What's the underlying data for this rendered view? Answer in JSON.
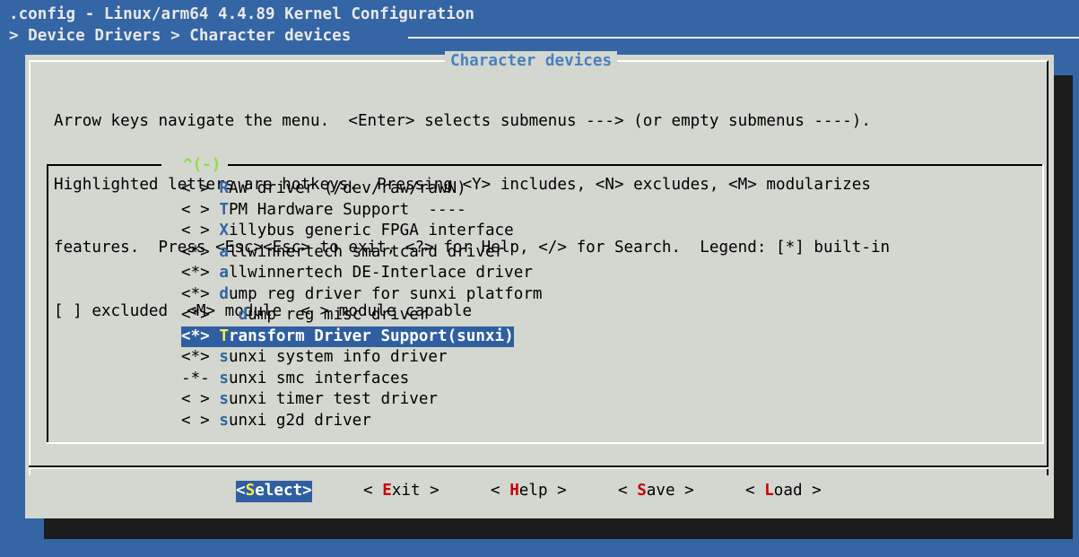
{
  "window": {
    "title": ".config - Linux/arm64 4.4.89 Kernel Configuration",
    "breadcrumb": "> Device Drivers > Character devices"
  },
  "dialog": {
    "title": "Character devices",
    "help_lines": [
      "Arrow keys navigate the menu.  <Enter> selects submenus ---> (or empty submenus ----).",
      "Highlighted letters are hotkeys.  Pressing <Y> includes, <N> excludes, <M> modularizes",
      "features.  Press <Esc><Esc> to exit, <?> for Help, </> for Search.  Legend: [*] built-in",
      "[ ] excluded  <M> module  < > module capable"
    ],
    "scroll_indicator": "^(-)"
  },
  "menu": {
    "items": [
      {
        "prefix": "< > ",
        "hot": "R",
        "rest": "AW driver (/dev/raw/rawN)"
      },
      {
        "prefix": "< > ",
        "hot": "T",
        "rest": "PM Hardware Support  ----"
      },
      {
        "prefix": "< > ",
        "hot": "X",
        "rest": "illybus generic FPGA interface"
      },
      {
        "prefix": "<*> ",
        "hot": "a",
        "rest": "llwinnertech smartcard driver"
      },
      {
        "prefix": "<*> ",
        "hot": "a",
        "rest": "llwinnertech DE-Interlace driver"
      },
      {
        "prefix": "<*> ",
        "hot": "d",
        "rest": "ump reg driver for sunxi platform"
      },
      {
        "prefix": "<*>   ",
        "hot": "d",
        "rest": "ump reg misc driver"
      },
      {
        "prefix": "<*> ",
        "hot": "T",
        "rest": "ransform Driver Support(sunxi)"
      },
      {
        "prefix": "<*> ",
        "hot": "s",
        "rest": "unxi system info driver"
      },
      {
        "prefix": "-*- ",
        "hot": "s",
        "rest": "unxi smc interfaces"
      },
      {
        "prefix": "< > ",
        "hot": "s",
        "rest": "unxi timer test driver"
      },
      {
        "prefix": "< > ",
        "hot": "s",
        "rest": "unxi g2d driver"
      }
    ]
  },
  "buttons": {
    "select": {
      "open": "<",
      "hot": "S",
      "rest": "elect>"
    },
    "exit": {
      "open": "< ",
      "hot": "E",
      "rest": "xit >"
    },
    "help": {
      "open": "< ",
      "hot": "H",
      "rest": "elp >"
    },
    "save": {
      "open": "< ",
      "hot": "S",
      "rest": "ave >"
    },
    "load": {
      "open": "< ",
      "hot": "L",
      "rest": "oad >"
    }
  },
  "colors": {
    "background": "#3465a4",
    "dialog": "#d3d7cf",
    "selection": "#2f5fa0",
    "hotkey_menu": "#3465a4",
    "hotkey_button": "#cc0000",
    "hotkey_selected": "#fce94f",
    "scroll_indicator": "#8ae234"
  }
}
